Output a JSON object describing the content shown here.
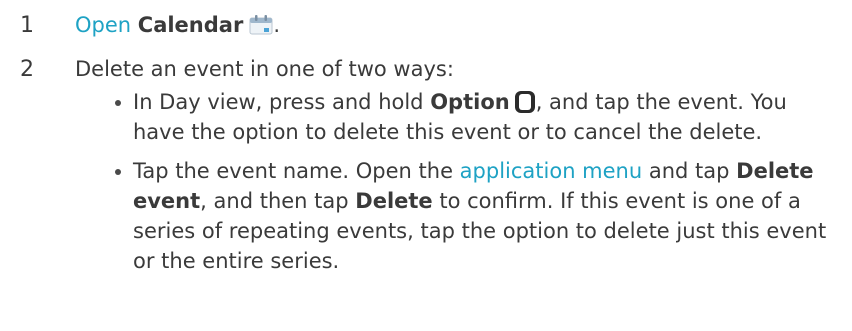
{
  "step1": {
    "number": "1",
    "link_text": "Open",
    "app_name": "Calendar",
    "trailing": "."
  },
  "step2": {
    "number": "2",
    "intro": "Delete an event in one of two ways:",
    "bullet1": {
      "text_a": "In Day view, press and hold ",
      "bold_option": "Option",
      "text_b": ", and tap the event. You have the option to delete this event or to cancel the delete."
    },
    "bullet2": {
      "text_a": "Tap the event name. Open the ",
      "link_menu": "application menu",
      "text_b": " and tap ",
      "bold_delete_event": "Delete event",
      "text_c": ", and then tap ",
      "bold_delete": "Delete",
      "text_d": " to confirm. If this event is one of a series of repeating events, tap the option to delete just this event or the entire series."
    }
  },
  "colors": {
    "link": "#1ea2c4",
    "text": "#3a3a3a"
  },
  "icons": {
    "calendar": "calendar-icon",
    "option_key": "option-key-icon"
  }
}
